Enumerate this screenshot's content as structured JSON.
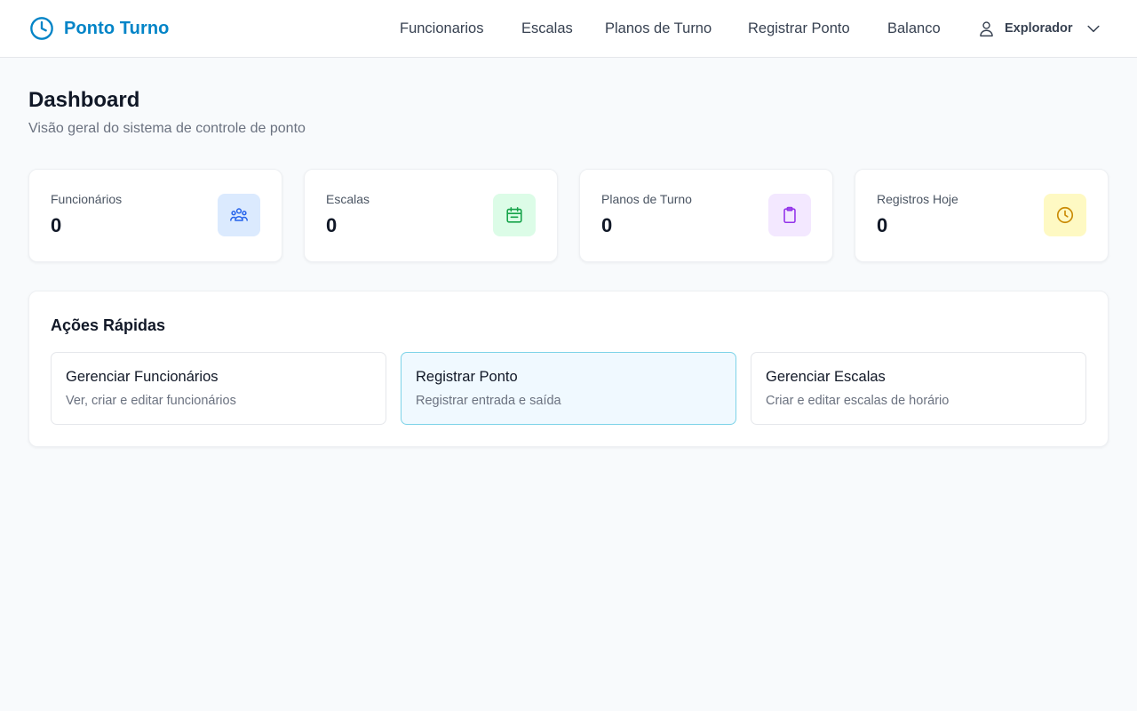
{
  "header": {
    "app_name": "Ponto Turno",
    "brand_color": "#0284c7",
    "logo_icon": "clock-icon",
    "nav": [
      {
        "label": "Funcionarios"
      },
      {
        "label": "Escalas"
      },
      {
        "label": "Planos de Turno"
      },
      {
        "label": "Registrar Ponto"
      },
      {
        "label": "Balanco"
      }
    ],
    "user": {
      "name": "Explorador",
      "icon": "user-icon",
      "menu_icon": "chevron-down-icon"
    }
  },
  "page": {
    "title": "Dashboard",
    "subtitle": "Visão geral do sistema de controle de ponto"
  },
  "stats": [
    {
      "label": "Funcionários",
      "value": "0",
      "icon": "users-icon",
      "color": "#2563eb",
      "bg": "#dbeafe"
    },
    {
      "label": "Escalas",
      "value": "0",
      "icon": "calendar-icon",
      "color": "#16a34a",
      "bg": "#dcfce7"
    },
    {
      "label": "Planos de Turno",
      "value": "0",
      "icon": "clipboard-icon",
      "color": "#9333ea",
      "bg": "#f3e8ff"
    },
    {
      "label": "Registros Hoje",
      "value": "0",
      "icon": "clock-icon",
      "color": "#ca8a04",
      "bg": "#fef9c3"
    }
  ],
  "quick_actions": {
    "title": "Ações Rápidas",
    "items": [
      {
        "title": "Gerenciar Funcionários",
        "description": "Ver, criar e editar funcionários"
      },
      {
        "title": "Registrar Ponto",
        "description": "Registrar entrada e saída",
        "active": true
      },
      {
        "title": "Gerenciar Escalas",
        "description": "Criar e editar escalas de horário"
      }
    ]
  }
}
